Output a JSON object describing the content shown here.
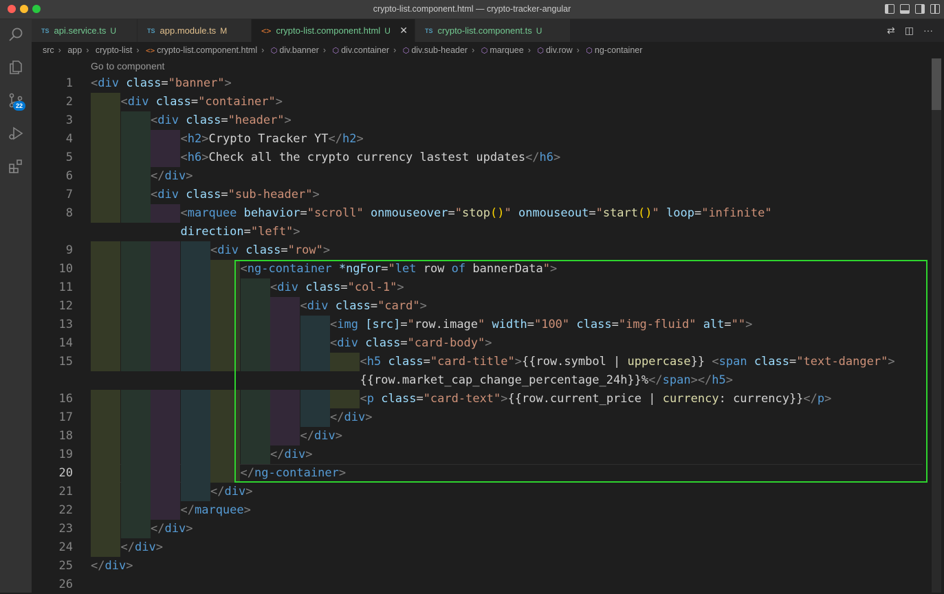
{
  "window": {
    "title": "crypto-list.component.html — crypto-tracker-angular"
  },
  "activity_bar": {
    "badge": "22"
  },
  "tabs": [
    {
      "icon": "TS",
      "label": "api.service.ts",
      "status": "U"
    },
    {
      "icon": "TS",
      "label": "app.module.ts",
      "status": "M"
    },
    {
      "icon": "<>",
      "label": "crypto-list.component.html",
      "status": "U"
    },
    {
      "icon": "TS",
      "label": "crypto-list.component.ts",
      "status": "U"
    }
  ],
  "breadcrumb": [
    "src",
    "app",
    "crypto-list",
    "crypto-list.component.html",
    "div.banner",
    "div.container",
    "div.sub-header",
    "marquee",
    "div.row",
    "ng-container"
  ],
  "codelens": "Go to component",
  "colors": {
    "guide_l1": "#353a26",
    "guide_l2": "#27352d",
    "guide_l3": "#332838",
    "guide_l4": "#25363a",
    "highlight": "#2ed52e"
  },
  "line_numbers": [
    "1",
    "2",
    "3",
    "4",
    "5",
    "6",
    "7",
    "8",
    "",
    "9",
    "10",
    "11",
    "12",
    "13",
    "14",
    "15",
    "",
    "16",
    "17",
    "18",
    "19",
    "20",
    "21",
    "22",
    "23",
    "24",
    "25",
    "26"
  ],
  "code": [
    [
      [
        "tg",
        "<"
      ],
      [
        "tn",
        "div"
      ],
      [
        "tx",
        " "
      ],
      [
        "at",
        "class"
      ],
      [
        "tx",
        "="
      ],
      [
        "av",
        "\"banner\""
      ],
      [
        "tg",
        ">"
      ]
    ],
    [
      [
        "tg",
        "<"
      ],
      [
        "tn",
        "div"
      ],
      [
        "tx",
        " "
      ],
      [
        "at",
        "class"
      ],
      [
        "tx",
        "="
      ],
      [
        "av",
        "\"container\""
      ],
      [
        "tg",
        ">"
      ]
    ],
    [
      [
        "tg",
        "<"
      ],
      [
        "tn",
        "div"
      ],
      [
        "tx",
        " "
      ],
      [
        "at",
        "class"
      ],
      [
        "tx",
        "="
      ],
      [
        "av",
        "\"header\""
      ],
      [
        "tg",
        ">"
      ]
    ],
    [
      [
        "tg",
        "<"
      ],
      [
        "tn",
        "h2"
      ],
      [
        "tg",
        ">"
      ],
      [
        "tx",
        "Crypto Tracker YT"
      ],
      [
        "tg",
        "</"
      ],
      [
        "tn",
        "h2"
      ],
      [
        "tg",
        ">"
      ]
    ],
    [
      [
        "tg",
        "<"
      ],
      [
        "tn",
        "h6"
      ],
      [
        "tg",
        ">"
      ],
      [
        "tx",
        "Check all the crypto currency lastest updates"
      ],
      [
        "tg",
        "</"
      ],
      [
        "tn",
        "h6"
      ],
      [
        "tg",
        ">"
      ]
    ],
    [
      [
        "tg",
        "</"
      ],
      [
        "tn",
        "div"
      ],
      [
        "tg",
        ">"
      ]
    ],
    [
      [
        "tg",
        "<"
      ],
      [
        "tn",
        "div"
      ],
      [
        "tx",
        " "
      ],
      [
        "at",
        "class"
      ],
      [
        "tx",
        "="
      ],
      [
        "av",
        "\"sub-header\""
      ],
      [
        "tg",
        ">"
      ]
    ],
    [
      [
        "tg",
        "<"
      ],
      [
        "tn",
        "marquee"
      ],
      [
        "tx",
        " "
      ],
      [
        "at",
        "behavior"
      ],
      [
        "tx",
        "="
      ],
      [
        "av",
        "\"scroll\""
      ],
      [
        "tx",
        " "
      ],
      [
        "at",
        "onmouseover"
      ],
      [
        "tx",
        "="
      ],
      [
        "av",
        "\""
      ],
      [
        "fn",
        "stop"
      ],
      [
        "br",
        "()"
      ],
      [
        "av",
        "\""
      ],
      [
        "tx",
        " "
      ],
      [
        "at",
        "onmouseout"
      ],
      [
        "tx",
        "="
      ],
      [
        "av",
        "\""
      ],
      [
        "fn",
        "start"
      ],
      [
        "br",
        "()"
      ],
      [
        "av",
        "\""
      ],
      [
        "tx",
        " "
      ],
      [
        "at",
        "loop"
      ],
      [
        "tx",
        "="
      ],
      [
        "av",
        "\"infinite\""
      ]
    ],
    [
      [
        "at",
        "direction"
      ],
      [
        "tx",
        "="
      ],
      [
        "av",
        "\"left\""
      ],
      [
        "tg",
        ">"
      ]
    ],
    [
      [
        "tg",
        "<"
      ],
      [
        "tn",
        "div"
      ],
      [
        "tx",
        " "
      ],
      [
        "at",
        "class"
      ],
      [
        "tx",
        "="
      ],
      [
        "av",
        "\"row\""
      ],
      [
        "tg",
        ">"
      ]
    ],
    [
      [
        "tg",
        "<"
      ],
      [
        "tn",
        "ng-container"
      ],
      [
        "tx",
        " "
      ],
      [
        "at",
        "*ngFor"
      ],
      [
        "tx",
        "="
      ],
      [
        "av",
        "\""
      ],
      [
        "kw",
        "let"
      ],
      [
        "tx",
        " row "
      ],
      [
        "kw",
        "of"
      ],
      [
        "tx",
        " bannerData"
      ],
      [
        "av",
        "\""
      ],
      [
        "tg",
        ">"
      ]
    ],
    [
      [
        "tg",
        "<"
      ],
      [
        "tn",
        "div"
      ],
      [
        "tx",
        " "
      ],
      [
        "at",
        "class"
      ],
      [
        "tx",
        "="
      ],
      [
        "av",
        "\"col-1\""
      ],
      [
        "tg",
        ">"
      ]
    ],
    [
      [
        "tg",
        "<"
      ],
      [
        "tn",
        "div"
      ],
      [
        "tx",
        " "
      ],
      [
        "at",
        "class"
      ],
      [
        "tx",
        "="
      ],
      [
        "av",
        "\"card\""
      ],
      [
        "tg",
        ">"
      ]
    ],
    [
      [
        "tg",
        "<"
      ],
      [
        "tn",
        "img"
      ],
      [
        "tx",
        " "
      ],
      [
        "at",
        "[src]"
      ],
      [
        "tx",
        "="
      ],
      [
        "av",
        "\""
      ],
      [
        "tx",
        "row.image"
      ],
      [
        "av",
        "\""
      ],
      [
        "tx",
        " "
      ],
      [
        "at",
        "width"
      ],
      [
        "tx",
        "="
      ],
      [
        "av",
        "\"100\""
      ],
      [
        "tx",
        " "
      ],
      [
        "at",
        "class"
      ],
      [
        "tx",
        "="
      ],
      [
        "av",
        "\"img-fluid\""
      ],
      [
        "tx",
        " "
      ],
      [
        "at",
        "alt"
      ],
      [
        "tx",
        "="
      ],
      [
        "av",
        "\"\""
      ],
      [
        "tg",
        ">"
      ]
    ],
    [
      [
        "tg",
        "<"
      ],
      [
        "tn",
        "div"
      ],
      [
        "tx",
        " "
      ],
      [
        "at",
        "class"
      ],
      [
        "tx",
        "="
      ],
      [
        "av",
        "\"card-body\""
      ],
      [
        "tg",
        ">"
      ]
    ],
    [
      [
        "tg",
        "<"
      ],
      [
        "tn",
        "h5"
      ],
      [
        "tx",
        " "
      ],
      [
        "at",
        "class"
      ],
      [
        "tx",
        "="
      ],
      [
        "av",
        "\"card-title\""
      ],
      [
        "tg",
        ">"
      ],
      [
        "tx",
        "{{row.symbol | "
      ],
      [
        "fn",
        "uppercase"
      ],
      [
        "tx",
        "}} "
      ],
      [
        "tg",
        "<"
      ],
      [
        "tn",
        "span"
      ],
      [
        "tx",
        " "
      ],
      [
        "at",
        "class"
      ],
      [
        "tx",
        "="
      ],
      [
        "av",
        "\"text-danger\""
      ],
      [
        "tg",
        ">"
      ]
    ],
    [
      [
        "tx",
        "{{row.market_cap_change_percentage_24h}}%"
      ],
      [
        "tg",
        "</"
      ],
      [
        "tn",
        "span"
      ],
      [
        "tg",
        "></"
      ],
      [
        "tn",
        "h5"
      ],
      [
        "tg",
        ">"
      ]
    ],
    [
      [
        "tg",
        "<"
      ],
      [
        "tn",
        "p"
      ],
      [
        "tx",
        " "
      ],
      [
        "at",
        "class"
      ],
      [
        "tx",
        "="
      ],
      [
        "av",
        "\"card-text\""
      ],
      [
        "tg",
        ">"
      ],
      [
        "tx",
        "{{row.current_price | "
      ],
      [
        "fn",
        "currency"
      ],
      [
        "tx",
        ": currency}}"
      ],
      [
        "tg",
        "</"
      ],
      [
        "tn",
        "p"
      ],
      [
        "tg",
        ">"
      ]
    ],
    [
      [
        "tg",
        "</"
      ],
      [
        "tn",
        "div"
      ],
      [
        "tg",
        ">"
      ]
    ],
    [
      [
        "tg",
        "</"
      ],
      [
        "tn",
        "div"
      ],
      [
        "tg",
        ">"
      ]
    ],
    [
      [
        "tg",
        "</"
      ],
      [
        "tn",
        "div"
      ],
      [
        "tg",
        ">"
      ]
    ],
    [
      [
        "tg",
        "</"
      ],
      [
        "tn",
        "ng-container"
      ],
      [
        "tg",
        ">"
      ]
    ],
    [
      [
        "tg",
        "</"
      ],
      [
        "tn",
        "div"
      ],
      [
        "tg",
        ">"
      ]
    ],
    [
      [
        "tg",
        "</"
      ],
      [
        "tn",
        "marquee"
      ],
      [
        "tg",
        ">"
      ]
    ],
    [
      [
        "tg",
        "</"
      ],
      [
        "tn",
        "div"
      ],
      [
        "tg",
        ">"
      ]
    ],
    [
      [
        "tg",
        "</"
      ],
      [
        "tn",
        "div"
      ],
      [
        "tg",
        ">"
      ]
    ],
    [
      [
        "tg",
        "</"
      ],
      [
        "tn",
        "div"
      ],
      [
        "tg",
        ">"
      ]
    ],
    []
  ]
}
